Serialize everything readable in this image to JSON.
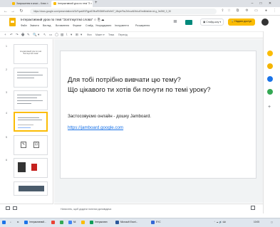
{
  "browser": {
    "tabs": [
      {
        "label": "Запрошення в класі – Ключ ×",
        "active": false,
        "color": "#fbbc04"
      },
      {
        "label": "Інтерактивний урок по темі \"З ×",
        "active": true,
        "color": "#fbbc04"
      }
    ],
    "new_tab": "+",
    "url": "https://docs.google.com/presentation/d/1kFqzaMVRgpdD9haRK8MEwWdhK7_MtqIeFbcZrthoaNXbkuE/edit#slide=id.g_0e2f6f_0_30"
  },
  "app": {
    "doc_title": "Інтерактивний урок по темі \"Зоптпкуптмі слова\"  ☆  ⎘  ☁",
    "menu": [
      "Файл",
      "Змінити",
      "Вигляд",
      "Вставлення",
      "Формат",
      "Слайд",
      "Упорядкувати",
      "Інструменти",
      "Розширення"
    ],
    "present_label": "▣ Слайд-шоу  ▾",
    "share_label": "🔒 Надати доступ",
    "toolbar_icons": [
      "+",
      "↶",
      "↷",
      "🖶",
      "✎",
      "🔍",
      "▾",
      "↖",
      "▭",
      "◯",
      "▧",
      "\\",
      "▾",
      "⊞",
      "▾",
      "Фон",
      "Макет ▾",
      "Тема",
      "Перехід"
    ]
  },
  "filmstrip": {
    "slides": [
      {
        "num": "1",
        "title": "Інтерактивний урок по темі \"Зоптпкуптмі слова\""
      },
      {
        "num": "2"
      },
      {
        "num": "3"
      },
      {
        "num": "4"
      },
      {
        "num": "5"
      },
      {
        "num": "6"
      }
    ],
    "selected": "4"
  },
  "slide": {
    "question_line1": "Для тобі потрібно вивчати цю тему?",
    "question_line2": "Що цікавого ти хотів би почути по темі уроку?",
    "jamboard_text": "Застосовуємо онлайн - дошку Jamboard.",
    "jamboard_link": "https://jamboard.google.com"
  },
  "notes": {
    "placeholder": "Натисніть, щоб додати нотатки доповідача"
  },
  "side_panel": {
    "icons": [
      {
        "name": "calendar-icon",
        "color": "#fbbc04"
      },
      {
        "name": "keep-icon",
        "color": "#f4b400"
      },
      {
        "name": "tasks-icon",
        "color": "#1a73e8"
      },
      {
        "name": "maps-icon",
        "color": "#34a853"
      }
    ],
    "add": "+"
  },
  "taskbar": {
    "items": [
      {
        "label": "Інтерактивний...",
        "color": "#1a73e8"
      },
      {
        "label": "",
        "color": "#ea4335"
      },
      {
        "label": "",
        "color": "#34a853"
      },
      {
        "label": "Мі",
        "color": "#4285f4"
      },
      {
        "label": "",
        "color": "#fbbc04"
      },
      {
        "label": "Інтерактивн",
        "color": "#0f9d58"
      },
      {
        "label": "Microsoft Excel...",
        "color": "#2b579a"
      },
      {
        "label": "EYC",
        "color": "#3367d6"
      }
    ],
    "clock": "10:05"
  }
}
